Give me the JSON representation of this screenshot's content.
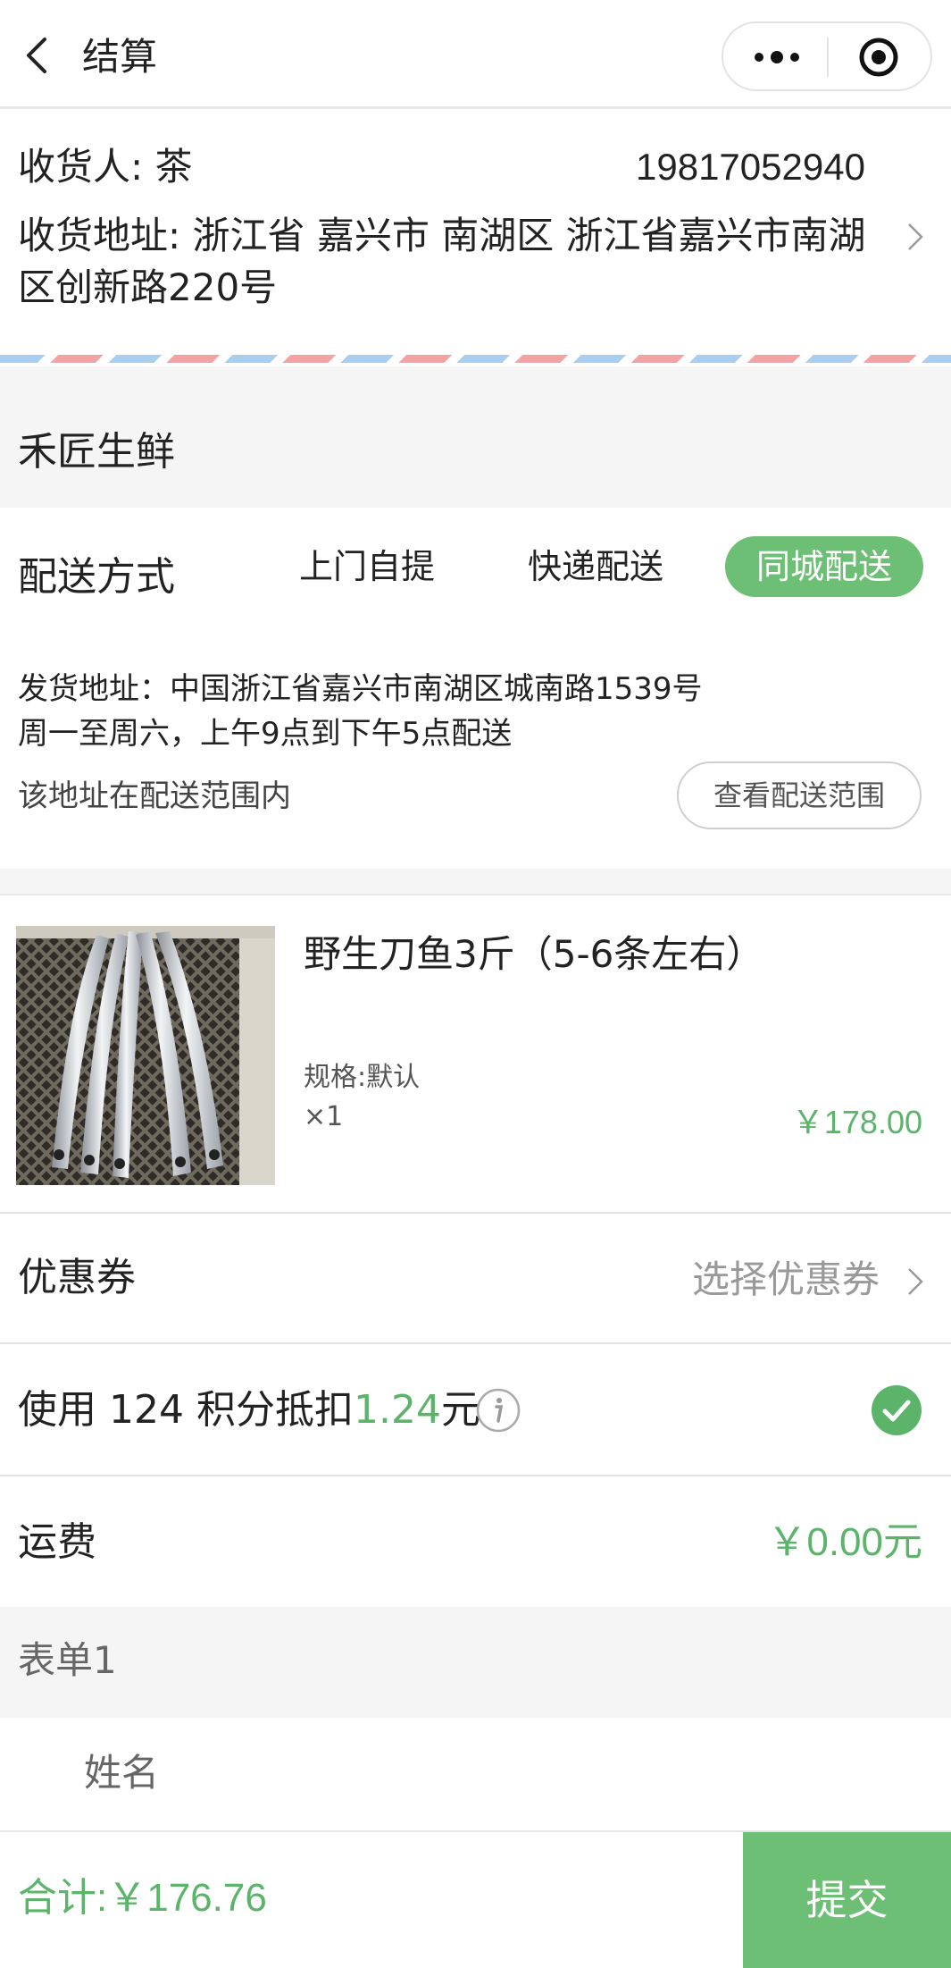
{
  "header": {
    "title": "结算"
  },
  "address": {
    "receiver": "收货人: 茶",
    "phone": "19817052940",
    "full_address": "收货地址: 浙江省 嘉兴市 南湖区 浙江省嘉兴市南湖区创新路220号"
  },
  "store": {
    "name": "禾匠生鲜"
  },
  "delivery": {
    "label": "配送方式",
    "options": [
      "上门自提",
      "快递配送",
      "同城配送"
    ],
    "selected": "同城配送",
    "ship_from": "发货地址：中国浙江省嘉兴市南湖区城南路1539号",
    "hours": "周一至周六，上午9点到下午5点配送",
    "range_status": "该地址在配送范围内",
    "range_button": "查看配送范围"
  },
  "product": {
    "name": "野生刀鱼3斤（5-6条左右）",
    "spec": "规格:默认",
    "quantity": "×1",
    "price": "￥178.00"
  },
  "coupon": {
    "label": "优惠券",
    "value": "选择优惠券"
  },
  "points": {
    "prefix": "使用 124 积分抵扣",
    "amount": "1.24",
    "suffix": "元",
    "checked": true
  },
  "freight": {
    "label": "运费",
    "value": "￥0.00元"
  },
  "form": {
    "title": "表单1",
    "field_label": "姓名"
  },
  "footer": {
    "total": "合计:￥176.76",
    "submit": "提交"
  },
  "colors": {
    "accent": "#6cbf75",
    "accent_text": "#5cb46a"
  }
}
